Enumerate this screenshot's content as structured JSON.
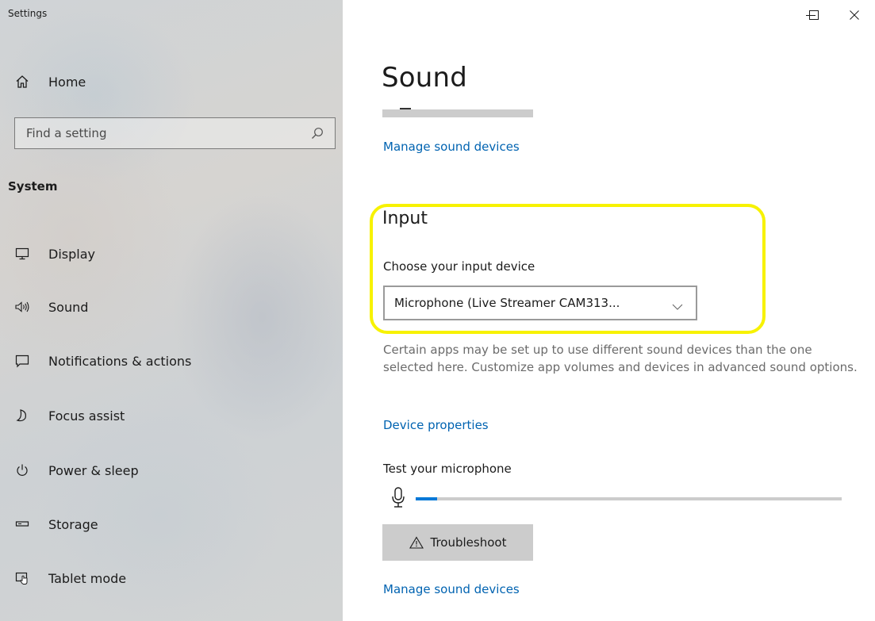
{
  "window": {
    "title": "Settings",
    "minimize_icon": "minimize-icon",
    "maximize_icon": "maximize-icon",
    "close_icon": "close-icon"
  },
  "sidebar": {
    "home": {
      "label": "Home",
      "icon": "home-icon"
    },
    "search": {
      "placeholder": "Find a setting",
      "value": "",
      "icon": "search-icon"
    },
    "section": "System",
    "items": [
      {
        "label": "Display",
        "icon": "monitor-icon"
      },
      {
        "label": "Sound",
        "icon": "speaker-icon"
      },
      {
        "label": "Notifications & actions",
        "icon": "notification-icon"
      },
      {
        "label": "Focus assist",
        "icon": "moon-icon"
      },
      {
        "label": "Power & sleep",
        "icon": "power-icon"
      },
      {
        "label": "Storage",
        "icon": "storage-icon"
      },
      {
        "label": "Tablet mode",
        "icon": "tablet-mode-icon"
      }
    ]
  },
  "main": {
    "title": "Sound",
    "manage_devices_top": "Manage sound devices",
    "input": {
      "heading": "Input",
      "choose_label": "Choose your input device",
      "device_selected": "Microphone (Live Streamer CAM313...",
      "description": "Certain apps may be set up to use different sound devices than the one selected here. Customize app volumes and devices in advanced sound options.",
      "device_properties": "Device properties",
      "test_label": "Test your microphone",
      "mic_level_fraction": 0.05,
      "troubleshoot": "Troubleshoot",
      "manage_devices_bottom": "Manage sound devices"
    }
  },
  "colors": {
    "accent": "#0078d7",
    "link": "#0063b1",
    "highlight": "#f7f200"
  }
}
